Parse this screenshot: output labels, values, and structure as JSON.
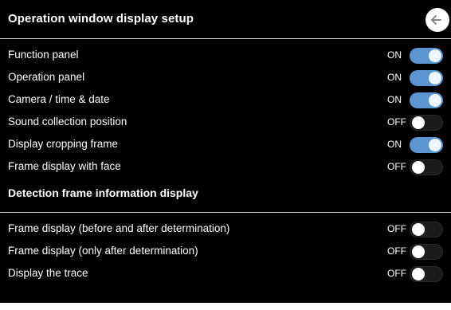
{
  "header": {
    "title": "Operation window display setup",
    "back_icon": "arrow-left-icon"
  },
  "display_settings": [
    {
      "label": "Function panel",
      "state": "ON"
    },
    {
      "label": "Operation panel",
      "state": "ON"
    },
    {
      "label": "Camera / time & date",
      "state": "ON"
    },
    {
      "label": "Sound collection position",
      "state": "OFF"
    },
    {
      "label": "Display cropping frame",
      "state": "ON"
    },
    {
      "label": "Frame display with face",
      "state": "OFF"
    }
  ],
  "detection_section": {
    "title": "Detection frame information display",
    "items": [
      {
        "label": "Frame display (before and after determination)",
        "state": "OFF"
      },
      {
        "label": "Frame display (only after determination)",
        "state": "OFF"
      },
      {
        "label": "Display the trace",
        "state": "OFF"
      }
    ]
  },
  "colors": {
    "background": "#000000",
    "toggle_on": "#5a95d0",
    "toggle_off": "#1b1b1b",
    "divider": "#cfcfcf"
  }
}
